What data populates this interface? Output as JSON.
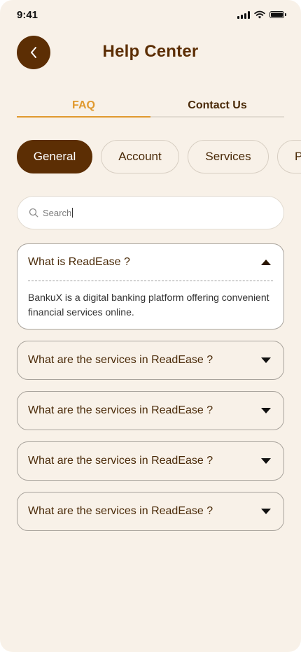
{
  "status_bar": {
    "time": "9:41",
    "icons": [
      "signal-icon",
      "wifi-icon",
      "battery-icon"
    ]
  },
  "header": {
    "title": "Help Center",
    "back_icon": "chevron-left-icon"
  },
  "tabs": [
    {
      "label": "FAQ",
      "active": true
    },
    {
      "label": "Contact Us",
      "active": false
    }
  ],
  "categories": [
    {
      "label": "General",
      "selected": true
    },
    {
      "label": "Account",
      "selected": false
    },
    {
      "label": "Services",
      "selected": false
    },
    {
      "label": "P",
      "selected": false
    }
  ],
  "search": {
    "placeholder": "Search",
    "value": "",
    "icon": "search-icon"
  },
  "faqs": [
    {
      "question": "What is ReadEase ?",
      "answer": "BankuX is a digital banking platform offering convenient financial services online.",
      "expanded": true
    },
    {
      "question": "What are the services in ReadEase ?",
      "expanded": false
    },
    {
      "question": "What are the services in ReadEase ?",
      "expanded": false
    },
    {
      "question": "What are the services in ReadEase ?",
      "expanded": false
    },
    {
      "question": "What are the services in ReadEase ?",
      "expanded": false
    }
  ],
  "colors": {
    "background": "#F8F1E8",
    "primary": "#5C2E04",
    "accent": "#E0992E",
    "text": "#4A2A08"
  }
}
